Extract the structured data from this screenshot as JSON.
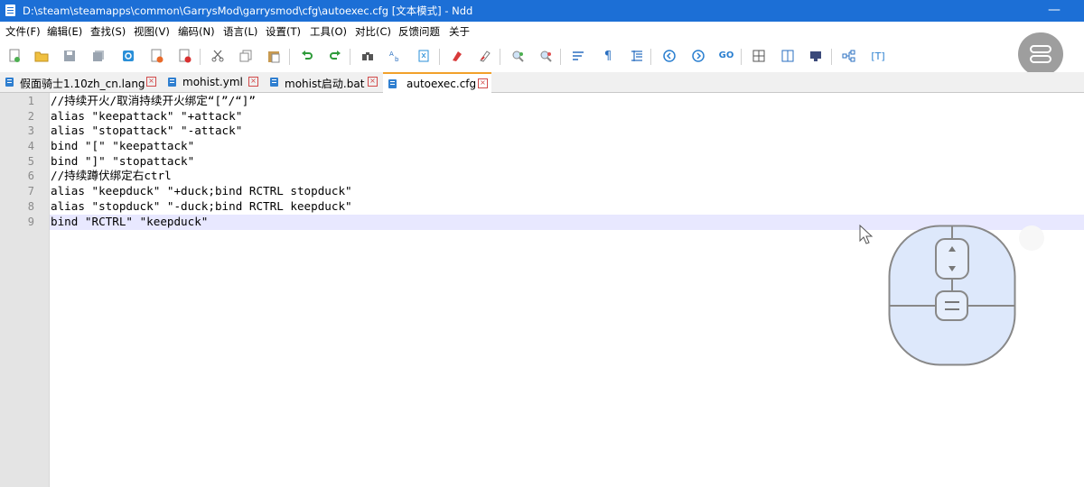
{
  "window": {
    "title": "D:\\steam\\steamapps\\common\\GarrysMod\\garrysmod\\cfg\\autoexec.cfg [文本模式] - Ndd",
    "minimize_glyph": "—"
  },
  "menu": [
    "文件(F)",
    "编辑(E)",
    "查找(S)",
    "视图(V)",
    "编码(N)",
    "语言(L)",
    "设置(T)",
    "工具(O)",
    "对比(C)",
    "反馈问题",
    "关于"
  ],
  "tabs": [
    {
      "label": "假面骑士1.10zh_cn.lang",
      "active": false
    },
    {
      "label": "mohist.yml",
      "active": false
    },
    {
      "label": "mohist启动.bat",
      "active": false
    },
    {
      "label": "autoexec.cfg",
      "active": true
    }
  ],
  "tab_close_glyph": "×",
  "editor": {
    "line_numbers": [
      "1",
      "2",
      "3",
      "4",
      "5",
      "6",
      "7",
      "8",
      "9"
    ],
    "current_line": 9,
    "lines": [
      "//持续开火/取消持续开火绑定“[”/“]”",
      "alias \"keepattack\" \"+attack\"",
      "alias \"stopattack\" \"-attack\"",
      "bind \"[\" \"keepattack\"",
      "bind \"]\" \"stopattack\"",
      "//持续蹲伏绑定右ctrl",
      "alias \"keepduck\" \"+duck;bind RCTRL stopduck\"",
      "alias \"stopduck\" \"-duck;bind RCTRL keepduck\"",
      "bind \"RCTRL\" \"keepduck\""
    ]
  },
  "toolbar_icons": [
    "new-file-icon",
    "open-file-icon",
    "save-icon",
    "save-all-icon",
    "reload-icon",
    "close-file-icon",
    "close-all-icon",
    "cut-icon",
    "copy-icon",
    "paste-icon",
    "undo-icon",
    "redo-icon",
    "find-icon",
    "replace-icon",
    "bookmark-icon",
    "mark-icon",
    "clear-mark-icon",
    "zoom-in-icon",
    "zoom-out-icon",
    "wrap-icon",
    "show-symbols-icon",
    "indent-guide-icon",
    "prev-icon",
    "next-icon",
    "goto-icon",
    "column-edit-icon",
    "compare-icon",
    "monitor-icon",
    "tree-icon",
    "text-mode-icon"
  ],
  "colors": {
    "titlebar": "#1c6fd6",
    "accent_tab": "#f2a12a",
    "current_line": "#e8e8ff",
    "mouse_fill": "#dde8fb"
  }
}
